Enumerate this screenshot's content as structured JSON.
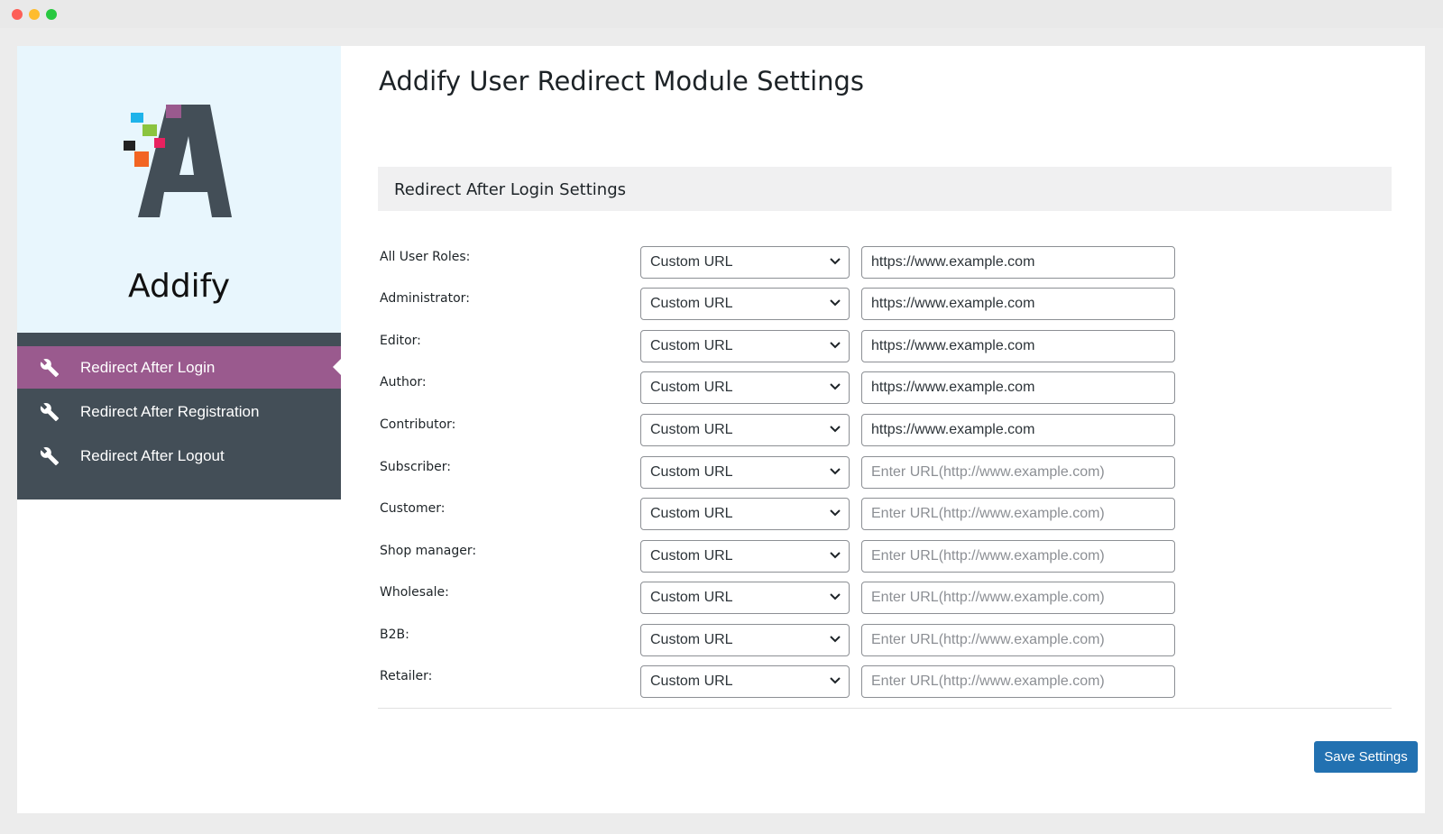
{
  "brand": {
    "name": "Addify",
    "logo_colors": [
      "#1fb3ea",
      "#9a5a8e",
      "#8bc43f",
      "#e8215f",
      "#222222",
      "#f26522",
      "#434e57"
    ]
  },
  "nav": {
    "items": [
      {
        "label": "Redirect After Login",
        "icon": "wrench-icon",
        "active": true
      },
      {
        "label": "Redirect After Registration",
        "icon": "wrench-icon",
        "active": false
      },
      {
        "label": "Redirect After Logout",
        "icon": "wrench-icon",
        "active": false
      }
    ]
  },
  "page": {
    "title": "Addify User Redirect Module Settings",
    "section_title": "Redirect After Login Settings"
  },
  "roles": [
    {
      "label": "All User Roles:",
      "option": "Custom URL",
      "url": "https://www.example.com",
      "placeholder": "Enter URL(http://www.example.com)"
    },
    {
      "label": "Administrator:",
      "option": "Custom URL",
      "url": "https://www.example.com",
      "placeholder": "Enter URL(http://www.example.com)"
    },
    {
      "label": "Editor:",
      "option": "Custom URL",
      "url": "https://www.example.com",
      "placeholder": "Enter URL(http://www.example.com)"
    },
    {
      "label": "Author:",
      "option": "Custom URL",
      "url": "https://www.example.com",
      "placeholder": "Enter URL(http://www.example.com)"
    },
    {
      "label": "Contributor:",
      "option": "Custom URL",
      "url": "https://www.example.com",
      "placeholder": "Enter URL(http://www.example.com)"
    },
    {
      "label": "Subscriber:",
      "option": "Custom URL",
      "url": "",
      "placeholder": "Enter URL(http://www.example.com)"
    },
    {
      "label": "Customer:",
      "option": "Custom URL",
      "url": "",
      "placeholder": "Enter URL(http://www.example.com)"
    },
    {
      "label": "Shop manager:",
      "option": "Custom URL",
      "url": "",
      "placeholder": "Enter URL(http://www.example.com)"
    },
    {
      "label": "Wholesale:",
      "option": "Custom URL",
      "url": "",
      "placeholder": "Enter URL(http://www.example.com)"
    },
    {
      "label": "B2B:",
      "option": "Custom URL",
      "url": "",
      "placeholder": "Enter URL(http://www.example.com)"
    },
    {
      "label": "Retailer:",
      "option": "Custom URL",
      "url": "",
      "placeholder": "Enter URL(http://www.example.com)"
    }
  ],
  "actions": {
    "save_label": "Save Settings"
  },
  "colors": {
    "nav_bg": "#434e57",
    "nav_active": "#9a5a8e",
    "brand_bg": "#e8f6fd",
    "primary_button": "#2271b1"
  }
}
